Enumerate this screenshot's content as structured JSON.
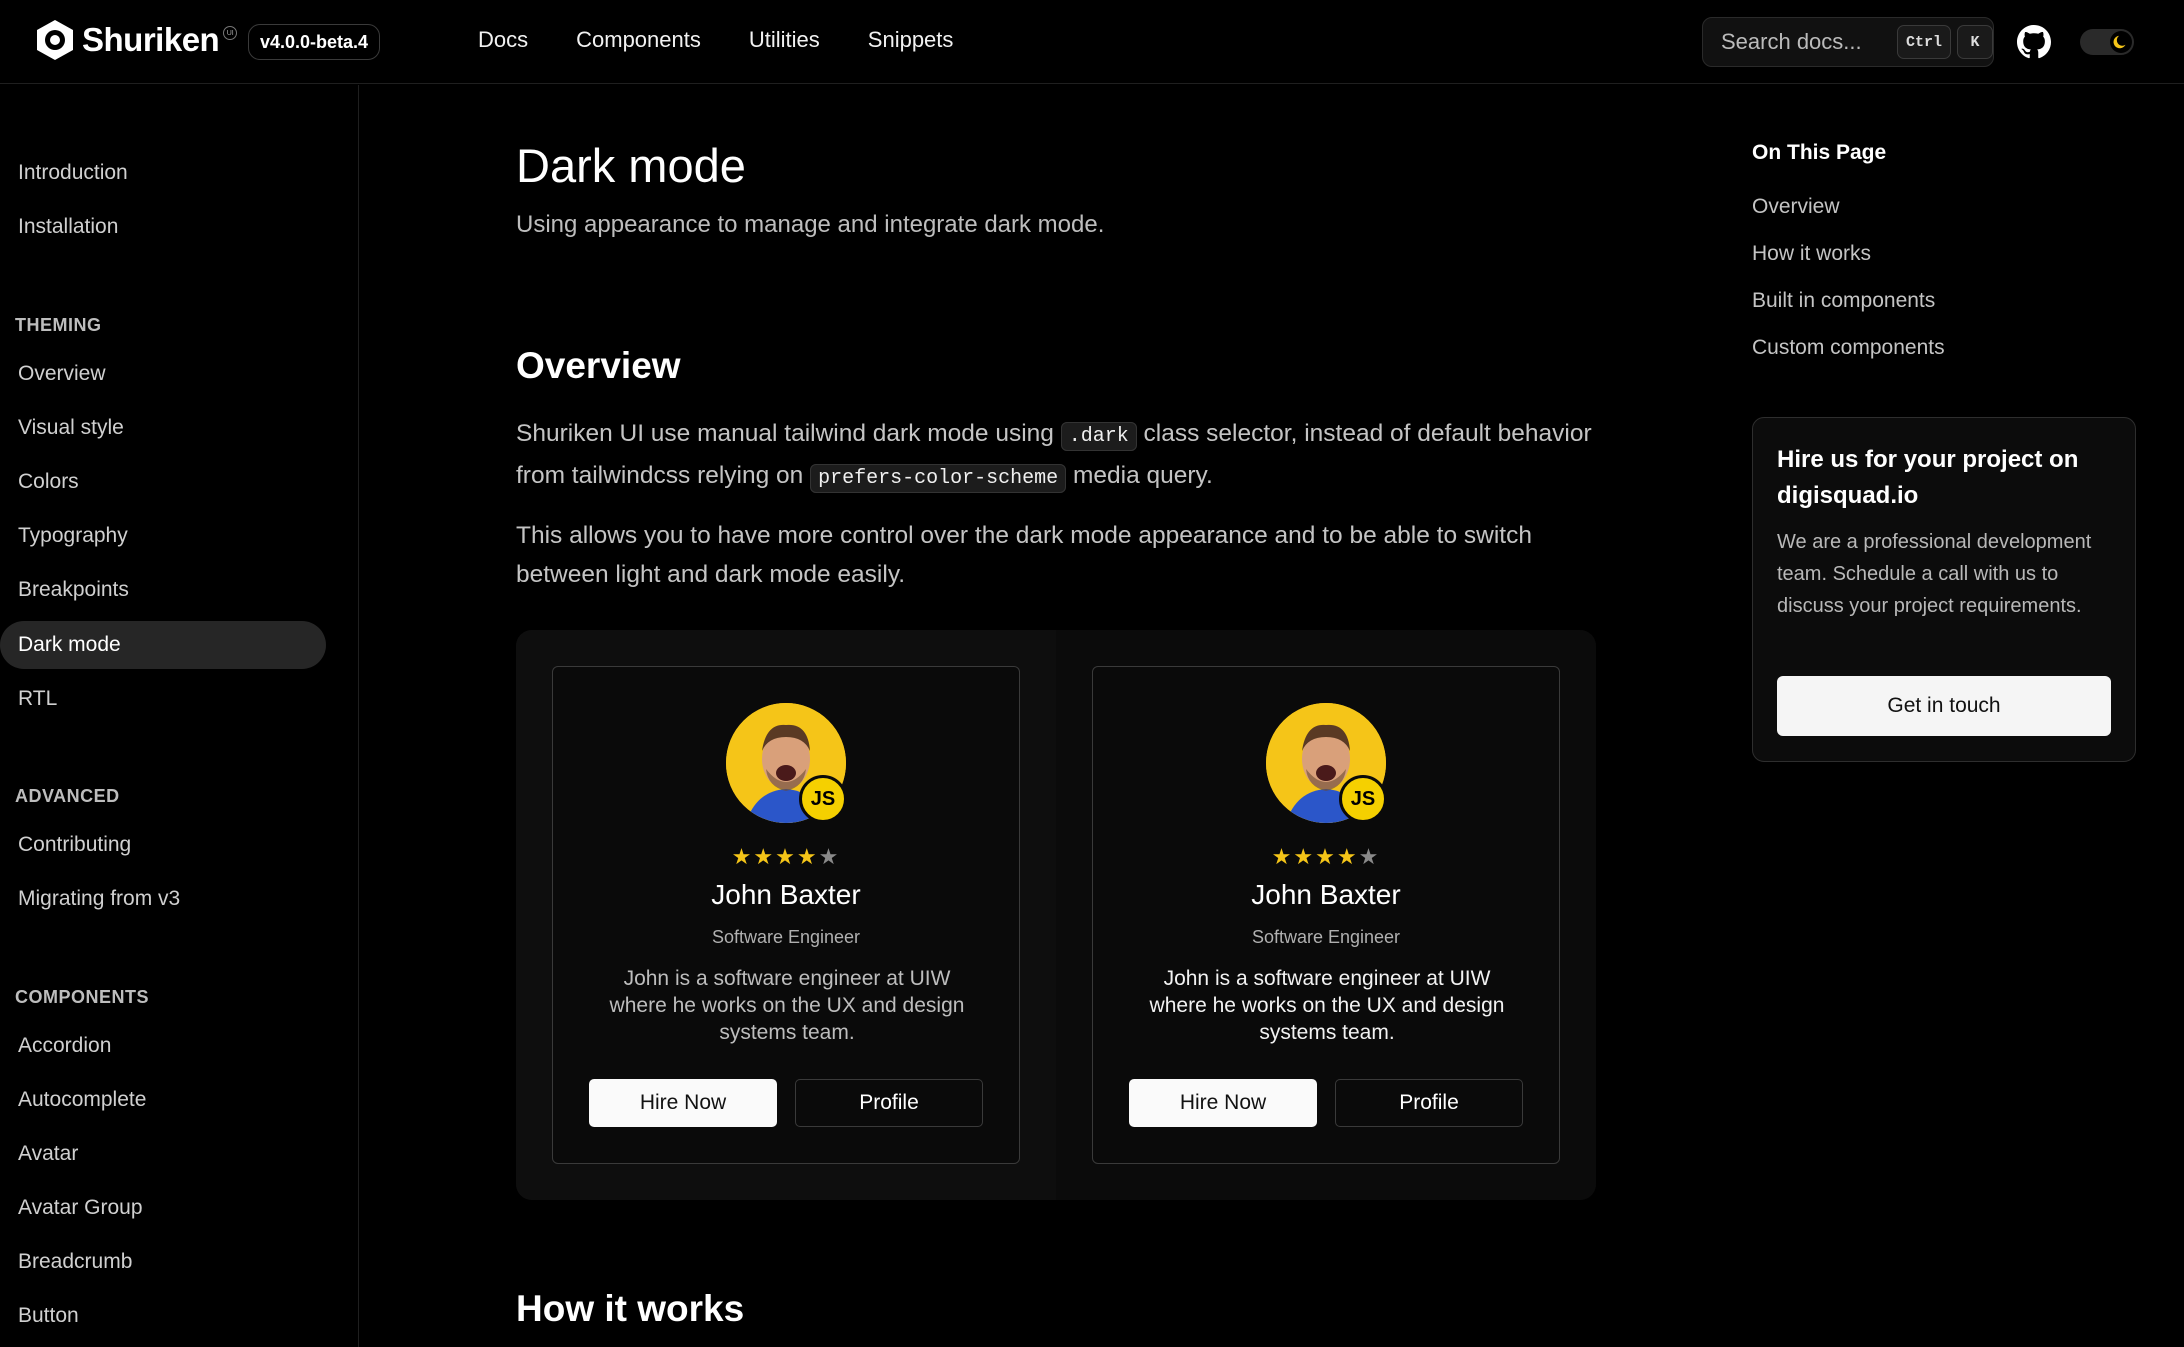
{
  "header": {
    "logo_text": "Shuriken",
    "logo_sup": "UI",
    "version": "v4.0.0-beta.4",
    "nav": [
      "Docs",
      "Components",
      "Utilities",
      "Snippets"
    ],
    "search_placeholder": "Search docs...",
    "kbd_ctrl": "Ctrl",
    "kbd_k": "K",
    "github_icon": "github-icon",
    "theme_icon": "moon-icon"
  },
  "sidebar": {
    "top_items": [
      "Introduction",
      "Installation"
    ],
    "theming_heading": "THEMING",
    "theming_items": [
      "Overview",
      "Visual style",
      "Colors",
      "Typography",
      "Breakpoints",
      "Dark mode",
      "RTL"
    ],
    "active_item": "Dark mode",
    "advanced_heading": "ADVANCED",
    "advanced_items": [
      "Contributing",
      "Migrating from v3"
    ],
    "components_heading": "COMPONENTS",
    "components_items": [
      "Accordion",
      "Autocomplete",
      "Avatar",
      "Avatar Group",
      "Breadcrumb",
      "Button"
    ]
  },
  "main": {
    "title": "Dark mode",
    "lead": "Using appearance to manage and integrate dark mode.",
    "overview_heading": "Overview",
    "p1_a": "Shuriken UI use manual tailwind dark mode using ",
    "p1_code1": ".dark",
    "p1_b": " class selector, instead of default behavior from tailwindcss relying on ",
    "p1_code2": "prefers-color-scheme",
    "p1_c": " media query.",
    "p2": "This allows you to have more control over the dark mode appearance and to be able to switch between light and dark mode easily.",
    "how_heading": "How it works",
    "cards": [
      {
        "rating": 4,
        "rating_max": 5,
        "badge": "JS",
        "name": "John Baxter",
        "role": "Software Engineer",
        "bio": "John is a software engineer at UIW where he works on the UX and design systems team.",
        "hire_label": "Hire Now",
        "profile_label": "Profile"
      },
      {
        "rating": 4,
        "rating_max": 5,
        "badge": "JS",
        "name": "John Baxter",
        "role": "Software Engineer",
        "bio": "John is a software engineer at UIW where he works on the UX and design systems team.",
        "hire_label": "Hire Now",
        "profile_label": "Profile"
      }
    ]
  },
  "toc": {
    "title": "On This Page",
    "items": [
      "Overview",
      "How it works",
      "Built in components",
      "Custom components"
    ]
  },
  "promo": {
    "title": "Hire us for your project on digisquad.io",
    "text": "We are a professional development team. Schedule a call with us to discuss your project requirements.",
    "button": "Get in touch"
  },
  "colors": {
    "accent_star": "#f5c518",
    "avatar_bg": "#f5c518",
    "background": "#000000"
  }
}
